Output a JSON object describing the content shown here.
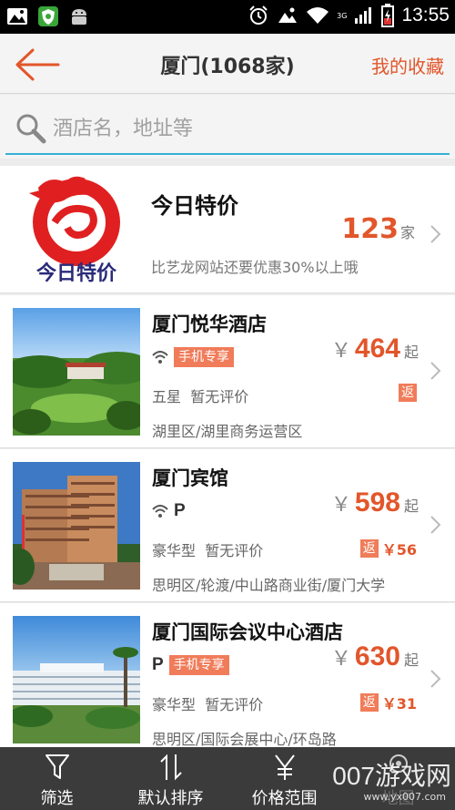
{
  "status_bar": {
    "time": "13:55",
    "network": "3G",
    "icons": [
      "photo-icon",
      "shield-app-icon",
      "android-icon",
      "alarm-icon",
      "image-icon",
      "wifi-icon",
      "signal-icon",
      "battery-icon"
    ]
  },
  "header": {
    "title": "厦门(1068家)",
    "favorites_label": "我的收藏",
    "accent_color": "#e2562a"
  },
  "search": {
    "placeholder": "酒店名，地址等"
  },
  "promo": {
    "logo_text": "今日特价",
    "title": "今日特价",
    "count": "123",
    "count_unit": "家",
    "description": "比艺龙网站还要优惠30%以上哦"
  },
  "hotels": [
    {
      "name": "厦门悦华酒店",
      "wifi": true,
      "parking": false,
      "mobile_tag": "手机专享",
      "currency": "￥",
      "price": "464",
      "price_suffix": "起",
      "star": "五星",
      "rating": "暂无评价",
      "rebate_tag": "返",
      "rebate_amount": "",
      "address": "湖里区/湖里商务运营区"
    },
    {
      "name": "厦门宾馆",
      "wifi": true,
      "parking": true,
      "parking_label": "P",
      "mobile_tag": "",
      "currency": "￥",
      "price": "598",
      "price_suffix": "起",
      "star": "豪华型",
      "rating": "暂无评价",
      "rebate_tag": "返",
      "rebate_amount": "￥56",
      "address": "思明区/轮渡/中山路商业街/厦门大学"
    },
    {
      "name": "厦门国际会议中心酒店",
      "wifi": false,
      "parking": true,
      "parking_label": "P",
      "mobile_tag": "手机专享",
      "currency": "￥",
      "price": "630",
      "price_suffix": "起",
      "star": "豪华型",
      "rating": "暂无评价",
      "rebate_tag": "返",
      "rebate_amount": "￥31",
      "address": "思明区/国际会展中心/环岛路"
    }
  ],
  "bottom_nav": {
    "items": [
      {
        "label": "筛选",
        "icon": "filter-icon"
      },
      {
        "label": "默认排序",
        "icon": "sort-icon"
      },
      {
        "label": "价格范围",
        "icon": "yen-icon"
      },
      {
        "label": "地图",
        "icon": "map-pin-icon"
      }
    ]
  },
  "watermark": {
    "text": "007游戏网",
    "sub": "www.yx007.com"
  }
}
